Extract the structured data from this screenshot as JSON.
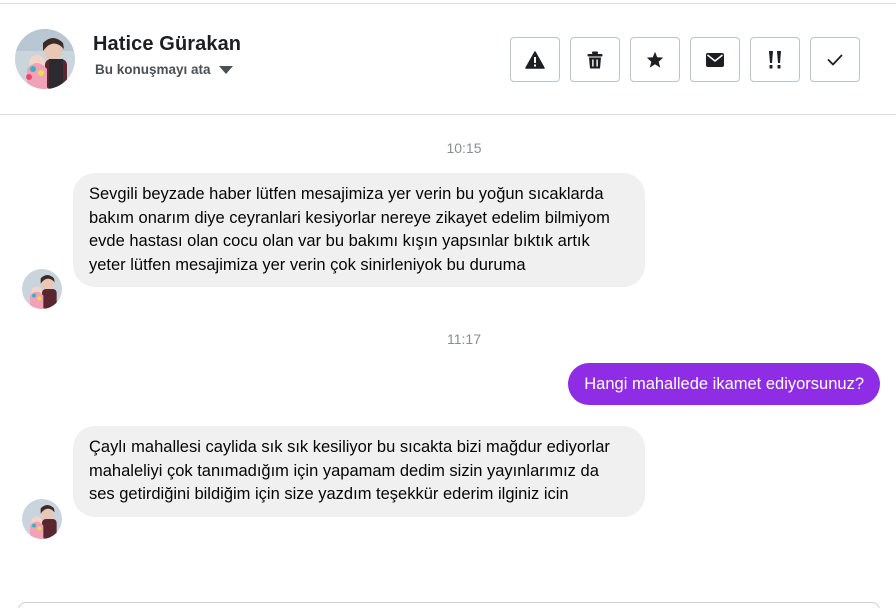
{
  "header": {
    "contact_name": "Hatice Gürakan",
    "assign_label": "Bu konuşmayı ata",
    "actions": [
      {
        "name": "report-button",
        "icon": "warning-icon"
      },
      {
        "name": "delete-button",
        "icon": "trash-icon"
      },
      {
        "name": "star-button",
        "icon": "star-icon"
      },
      {
        "name": "mark-unread-button",
        "icon": "envelope-icon"
      },
      {
        "name": "priority-button",
        "icon": "double-exclamation-icon"
      },
      {
        "name": "mark-done-button",
        "icon": "checkmark-icon"
      }
    ]
  },
  "conversation": {
    "timestamps": [
      "10:15",
      "11:17"
    ],
    "messages": [
      {
        "direction": "incoming",
        "text": "Sevgili beyzade haber lütfen mesajimiza yer verin bu yoğun sıcaklarda bakım onarım diye ceyranlari kesiyorlar nereye zikayet  edelim bilmiyom evde hastası olan cocu olan var bu bakımı kışın yapsınlar bıktık artık yeter lütfen mesajimiza yer verin çok sinirleniyok bu duruma"
      },
      {
        "direction": "outgoing",
        "text": "Hangi mahallede ikamet ediyorsunuz?"
      },
      {
        "direction": "incoming",
        "text": "Çaylı  mahallesi  caylida sık sık kesiliyor bu sıcakta bizi mağdur ediyorlar mahaleliyi çok tanımadığım için yapamam dedim sizin yayınlarımız da ses getirdiğini bildiğim için size yazdım teşekkür ederim ilginiz icin"
      }
    ]
  },
  "colors": {
    "outgoing_bubble": "#8f2de6",
    "incoming_bubble": "#f0f0f0",
    "timestamp": "#8a8d91",
    "divider": "#dadde1"
  }
}
